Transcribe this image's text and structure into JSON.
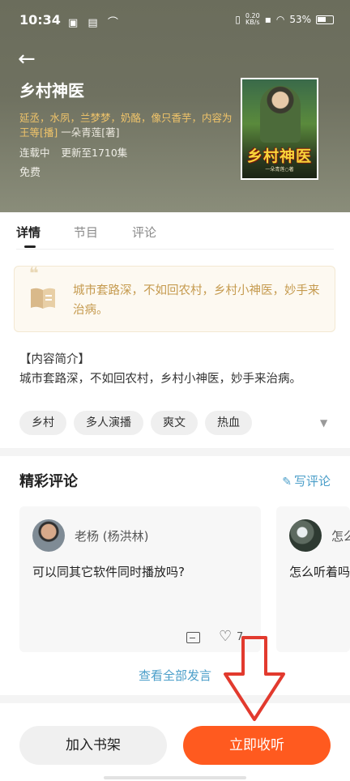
{
  "status_bar": {
    "time": "10:34",
    "left_icons": "▣ ▤ ⌒",
    "net_speed_value": "0.20",
    "net_speed_unit": "KB/s",
    "battery": "53%"
  },
  "header": {
    "book_title": "乡村神医",
    "actors": "延丞，水夙，兰梦梦，奶酪，像只香芋，内容为王等[播]",
    "author": "一朵青莲[著]",
    "serial_status": "连载中",
    "episodes": "更新至1710集",
    "price": "免费",
    "cover_title": "乡村神医",
    "cover_subtitle": "一朵青莲○著"
  },
  "tabs": [
    {
      "label": "详情"
    },
    {
      "label": "节目"
    },
    {
      "label": "评论"
    }
  ],
  "summary": {
    "text": "城市套路深，不如回农村，乡村小神医，妙手来治病。"
  },
  "intro": {
    "title": "【内容简介】",
    "text": "城市套路深，不如回农村，乡村小神医，妙手来治病。"
  },
  "tags": [
    "乡村",
    "多人演播",
    "爽文",
    "热血"
  ],
  "comments": {
    "title": "精彩评论",
    "write_label": "写评论",
    "items": [
      {
        "user": "老杨 (杨洪林)",
        "text": "可以同其它软件同时播放吗?",
        "likes": "7"
      },
      {
        "user": "怎么",
        "text": "怎么听着吗"
      }
    ],
    "view_all": "查看全部发言"
  },
  "bottom": {
    "add_shelf": "加入书架",
    "listen_now": "立即收听"
  },
  "colors": {
    "accent_orange": "#ff5a1f",
    "link_blue": "#4a9ec9",
    "actor_gold": "#f0c46a",
    "annotation_red": "#e23a2e"
  }
}
